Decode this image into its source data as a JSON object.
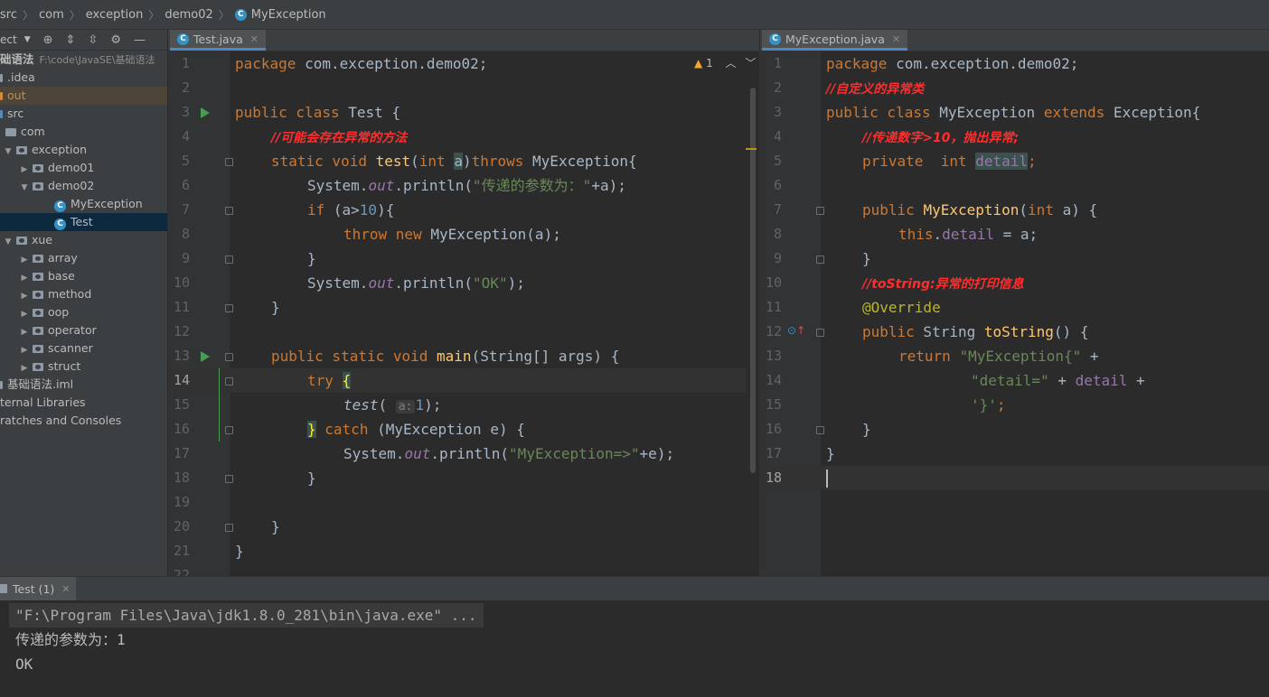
{
  "breadcrumb": [
    "src",
    "com",
    "exception",
    "demo02",
    "MyException"
  ],
  "project_panel": {
    "header_label": "ect",
    "root_name": "础语法",
    "root_path": "F:\\code\\JavaSE\\基础语法",
    "items": [
      {
        "label": ".idea"
      },
      {
        "label": "out"
      },
      {
        "label": "src"
      },
      {
        "label": "com"
      },
      {
        "label": "exception"
      },
      {
        "label": "demo01"
      },
      {
        "label": "demo02"
      },
      {
        "label": "MyException"
      },
      {
        "label": "Test"
      },
      {
        "label": "xue"
      },
      {
        "label": "array"
      },
      {
        "label": "base"
      },
      {
        "label": "method"
      },
      {
        "label": "oop"
      },
      {
        "label": "operator"
      },
      {
        "label": "scanner"
      },
      {
        "label": "struct"
      },
      {
        "label": "基础语法.iml"
      },
      {
        "label": "ternal Libraries"
      },
      {
        "label": "ratches and Consoles"
      }
    ]
  },
  "left_editor": {
    "tab_label": "Test.java",
    "warning_count": "1",
    "line_numbers": [
      "1",
      "2",
      "3",
      "4",
      "5",
      "6",
      "7",
      "8",
      "9",
      "10",
      "11",
      "12",
      "13",
      "14",
      "15",
      "16",
      "17",
      "18",
      "19",
      "20",
      "21",
      "22"
    ],
    "current_line": "14",
    "tokens": {
      "l1_kw": "package",
      "l1_rest": " com.exception.demo02;",
      "l3_kw": "public class",
      "l3_rest": " Test {",
      "l4_comment": "//可能会存在异常的方法",
      "l5_kw": "static void",
      "l5_fn": "test",
      "l5_p1": "(",
      "l5_kw2": "int",
      "l5_a": "a",
      "l5_p2": ")",
      "l5_kw3": "throws",
      "l5_rest": " MyException{",
      "l6_a": "System.",
      "l6_out": "out",
      "l6_b": ".println(",
      "l6_str": "\"传递的参数为：\"",
      "l6_c": "+a);",
      "l7_kw": "if",
      "l7_a": " (a>",
      "l7_num": "10",
      "l7_b": "){",
      "l8_kw": "throw new",
      "l8_rest": " MyException(a);",
      "l9": "}",
      "l10_a": "System.",
      "l10_out": "out",
      "l10_b": ".println(",
      "l10_str": "\"OK\"",
      "l10_c": ");",
      "l11": "}",
      "l13_kw": "public static void",
      "l13_fn": "main",
      "l13_rest": "(String[] args) {",
      "l14_kw": "try",
      "l14_brace": "{",
      "l15_fn": "test",
      "l15_p": "(",
      "l15_hint": "a:",
      "l15_num": "1",
      "l15_end": ");",
      "l16_brace": "}",
      "l16_kw": "catch",
      "l16_rest": " (MyException e) {",
      "l17_a": "System.",
      "l17_out": "out",
      "l17_b": ".println(",
      "l17_str": "\"MyException=>\"",
      "l17_c": "+e);",
      "l18": "}",
      "l20": "}",
      "l21": "}"
    }
  },
  "right_editor": {
    "tab_label": "MyException.java",
    "line_numbers": [
      "1",
      "2",
      "3",
      "4",
      "5",
      "6",
      "7",
      "8",
      "9",
      "10",
      "11",
      "12",
      "13",
      "14",
      "15",
      "16",
      "17",
      "18"
    ],
    "current_line": "18",
    "tokens": {
      "l1_kw": "package",
      "l1_rest": " com.exception.demo02;",
      "l2_comment": "//自定义的异常类",
      "l3_kw": "public class",
      "l3_a": " MyException ",
      "l3_kw2": "extends",
      "l3_b": " Exception{",
      "l4_comment": "//传递数字>10，抛出异常;",
      "l5_kw": "private  int",
      "l5_fld": "detail",
      "l5_end": ";",
      "l7_kw": "public",
      "l7_fn": "MyException",
      "l7_p": "(",
      "l7_kw2": "int",
      "l7_rest": " a) {",
      "l8_kw": "this",
      "l8_dot": ".",
      "l8_fld": "detail",
      "l8_rest": " = a;",
      "l9": "}",
      "l10_comment": "//toString:异常的打印信息",
      "l11_ann": "@Override",
      "l12_kw": "public",
      "l12_a": " String ",
      "l12_fn": "toString",
      "l12_rest": "() {",
      "l13_kw": "return",
      "l13_str": "\"MyException{\"",
      "l13_plus": " +",
      "l14_str": "\"detail=\"",
      "l14_plus": " + ",
      "l14_fld": "detail",
      "l14_plus2": " +",
      "l15_str": "'}'",
      "l15_end": ";",
      "l16": "}",
      "l17": "}"
    }
  },
  "run_panel": {
    "tab_label": "Test (1)",
    "output": [
      "\"F:\\Program Files\\Java\\jdk1.8.0_281\\bin\\java.exe\" ...",
      "传递的参数为：1",
      "OK"
    ]
  },
  "colors": {
    "keyword": "#cc7832",
    "comment": "#ff2d2d",
    "string": "#6a8759",
    "number": "#6897bb",
    "field": "#9876aa",
    "function": "#ffc66d",
    "annotation": "#bbb529",
    "selection": "#0d293e"
  }
}
